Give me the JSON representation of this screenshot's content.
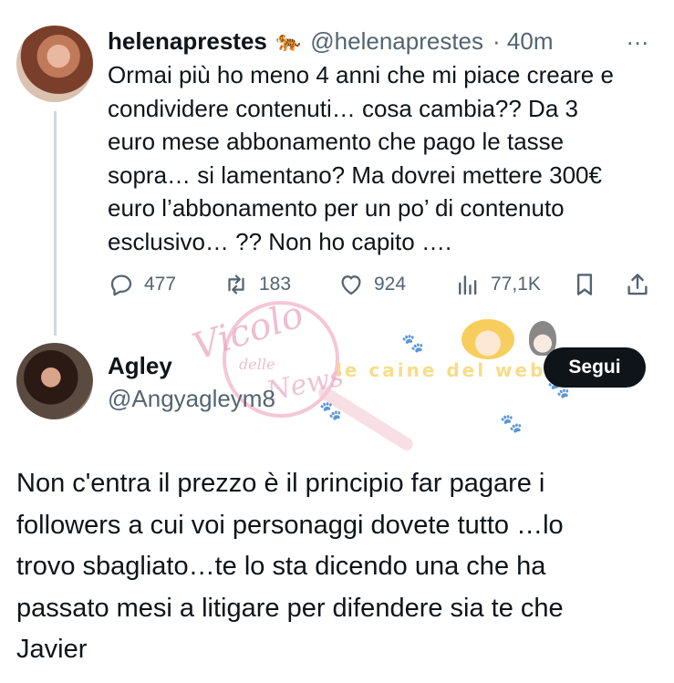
{
  "tweet1": {
    "display_name": "helenaprestes",
    "badge_emoji": "🐅",
    "handle": "@helenaprestes",
    "time": "· 40m",
    "more_icon": "…",
    "lines": [
      "Ormai più ho meno 4 anni che mi piace creare e",
      "condividere contenuti… cosa cambia??  Da 3",
      "euro mese abbonamento che pago le tasse",
      "sopra… si lamentano?  Ma dovrei mettere 300€",
      "euro l’abbonamento per un po’ di contenuto",
      "esclusivo… ?? Non ho capito …."
    ],
    "actions": {
      "replies": "477",
      "retweets": "183",
      "likes": "924",
      "views": "77,1K"
    }
  },
  "tweet2": {
    "display_name": "Agley",
    "handle": "@Angyagleym8",
    "follow_label": "Segui",
    "lines": [
      "Non c'entra il prezzo è il principio far pagare i",
      "followers a cui voi personaggi dovete tutto …lo",
      "trovo sbagliato…te lo sta dicendo una che ha",
      "passato mesi a litigare per difendere sia te che",
      "Javier"
    ]
  },
  "watermark": {
    "script_top": "Vicolo",
    "script_small": "delle",
    "script_bottom": "News",
    "banner": "le caine del web"
  },
  "colors": {
    "text": "#0f1419",
    "secondary": "#536471",
    "thread_line": "#cfd9de",
    "button": "#0f1419"
  }
}
